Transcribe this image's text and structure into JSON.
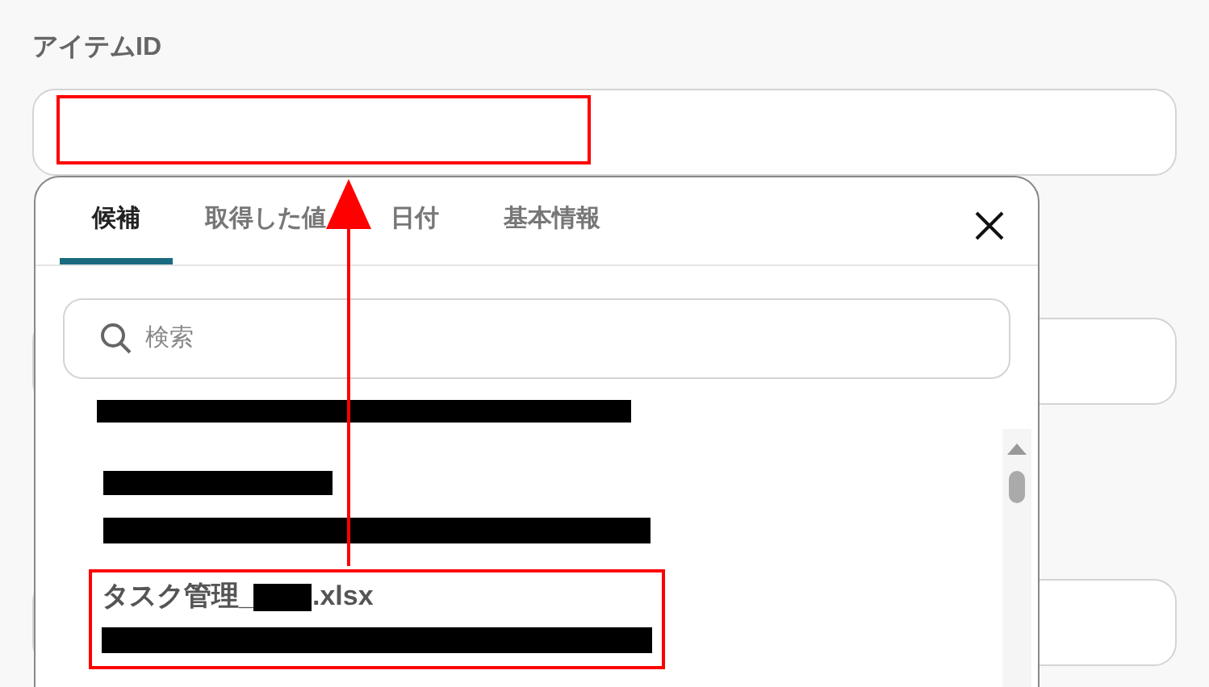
{
  "field": {
    "label": "アイテムID"
  },
  "tabs": [
    {
      "label": "候補",
      "selected": true
    },
    {
      "label": "取得した値",
      "selected": false
    },
    {
      "label": "日付",
      "selected": false
    },
    {
      "label": "基本情報",
      "selected": false
    }
  ],
  "search": {
    "placeholder": "検索"
  },
  "items": [
    {
      "kind": "redacted",
      "highlighted": false
    },
    {
      "kind": "redacted_pair",
      "highlighted": false
    },
    {
      "kind": "file",
      "title_prefix": "タスク管理_",
      "title_suffix": ".xlsx",
      "highlighted": true
    }
  ]
}
